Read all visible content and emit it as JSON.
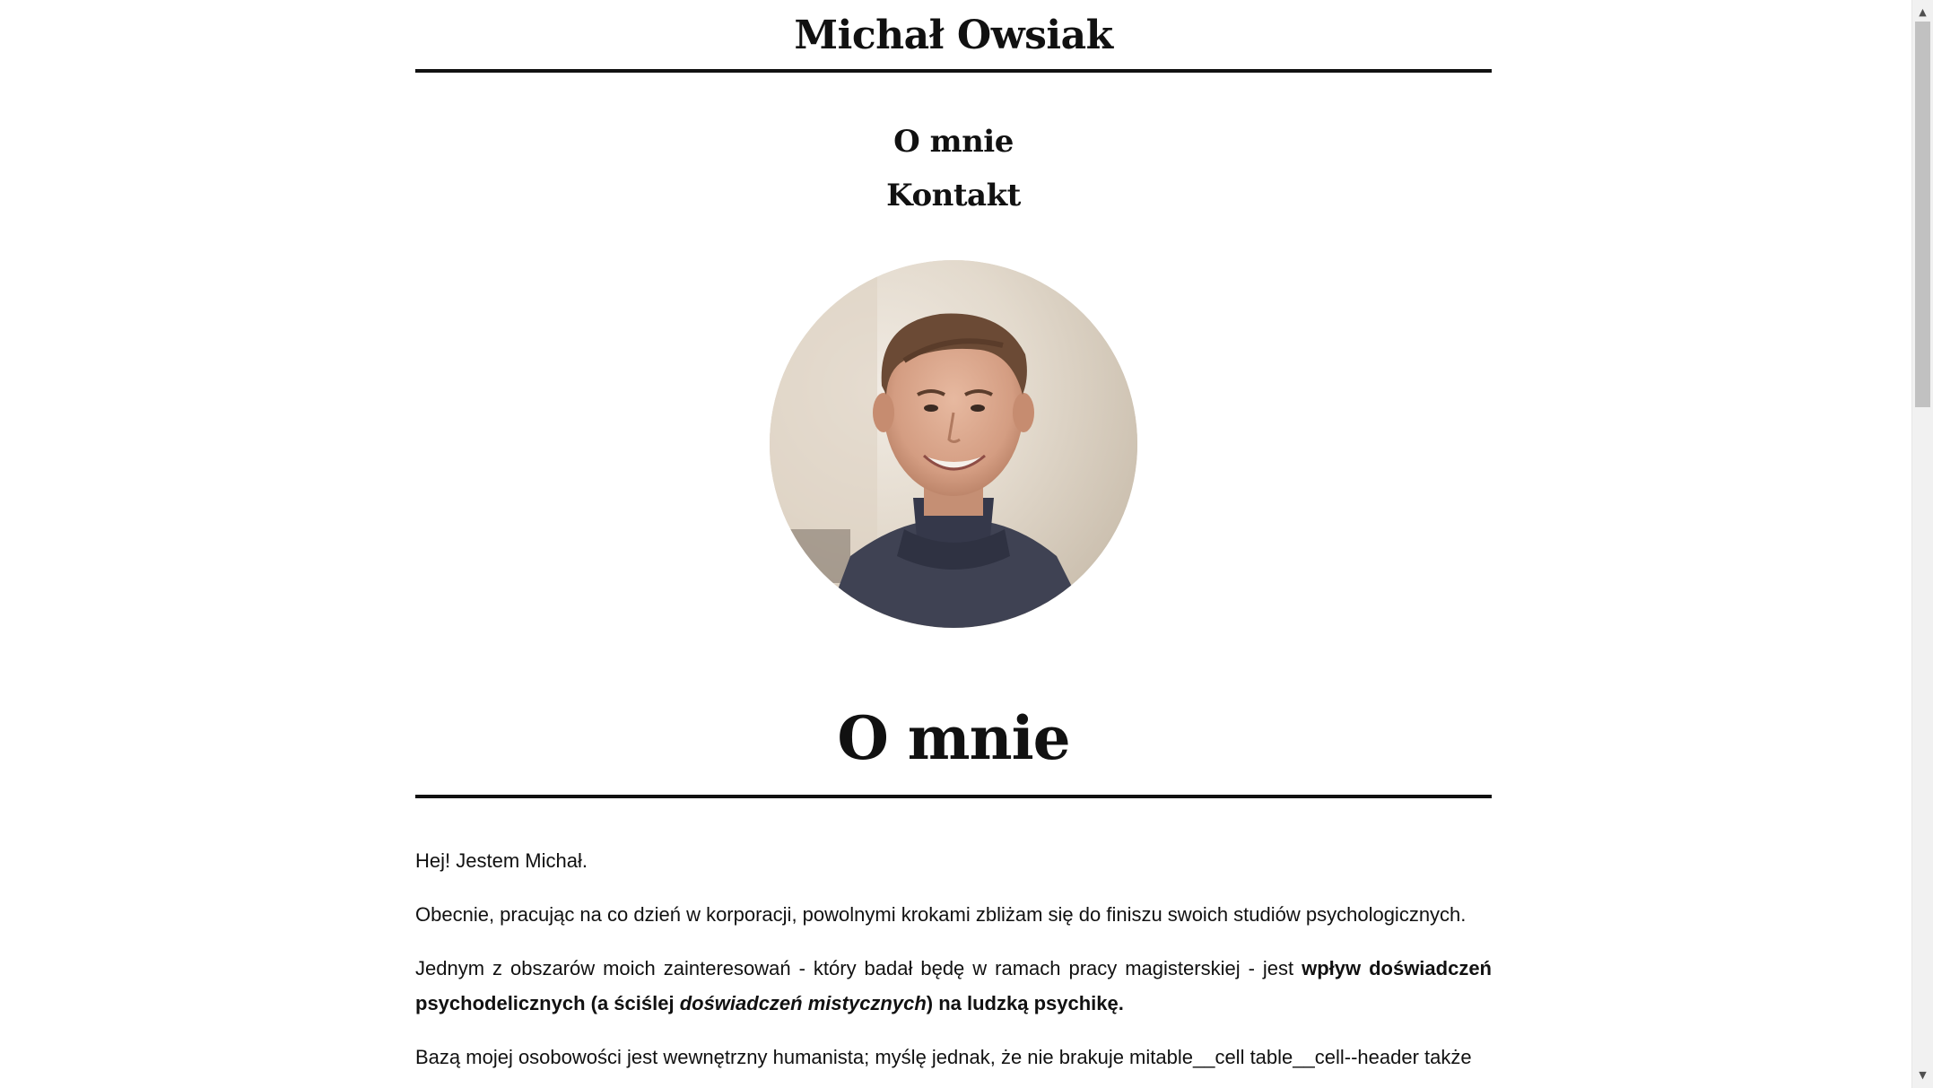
{
  "header": {
    "site_title": "Michał Owsiak"
  },
  "nav": {
    "items": [
      {
        "label": "O mnie"
      },
      {
        "label": "Kontakt"
      }
    ]
  },
  "section": {
    "title": "O mnie"
  },
  "content": {
    "p1": "Hej! Jestem Michał.",
    "p2": "Obecnie, pracując na co dzień w korporacji, powolnymi krokami zbliżam się do finiszu swoich studiów psychologicznych.",
    "p3_start": "Jednym z obszarów moich zainteresowań - który badał będę w ramach pracy magisterskiej - jest ",
    "p3_bold_a": "wpływ doświadczeń psychodelicznych (a ściślej ",
    "p3_bold_italic": "doświadczeń mistycznych",
    "p3_bold_b": ") na ludzką psychikę.",
    "p4": "Bazą mojej osobowości jest wewnętrzny humanista; myślę jednak, że nie brakuje mitable__cell table__cell--header także"
  },
  "icons": {
    "scroll_up": "scroll-up-arrow-icon",
    "scroll_down": "scroll-down-arrow-icon"
  },
  "colors": {
    "text": "#111111",
    "background": "#ffffff",
    "rule": "#111111"
  }
}
